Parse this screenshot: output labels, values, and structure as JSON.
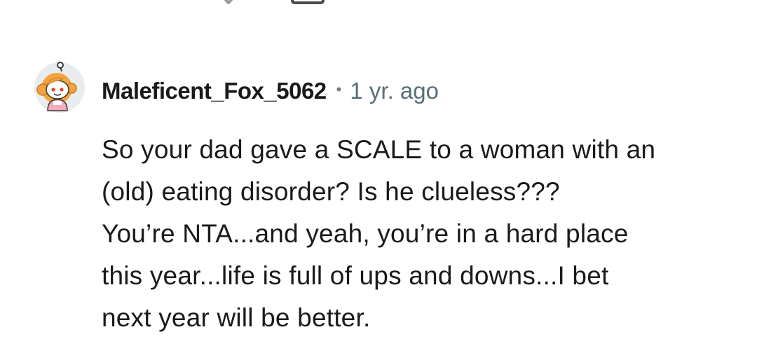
{
  "comment": {
    "username": "Maleficent_Fox_5062",
    "separator": "•",
    "timestamp": "1 yr. ago",
    "body_lines": [
      "So your dad gave a SCALE to a woman with an",
      "(old) eating disorder? Is he clueless???",
      "You’re NTA...and yeah, you’re in a hard place",
      "this year...life is full of ups and downs...I bet",
      "next year will be better."
    ],
    "avatar_icon": "snoo-avatar-icon"
  },
  "top_actions": {
    "icons": [
      "share-icon",
      "downvote-icon",
      "reply-icon"
    ]
  },
  "colors": {
    "text": "#1a1a1b",
    "meta": "#576f76",
    "icon_gray": "#9a9a9a",
    "avatar_hair": "#f4a340",
    "avatar_bg": "#e9ecef"
  }
}
